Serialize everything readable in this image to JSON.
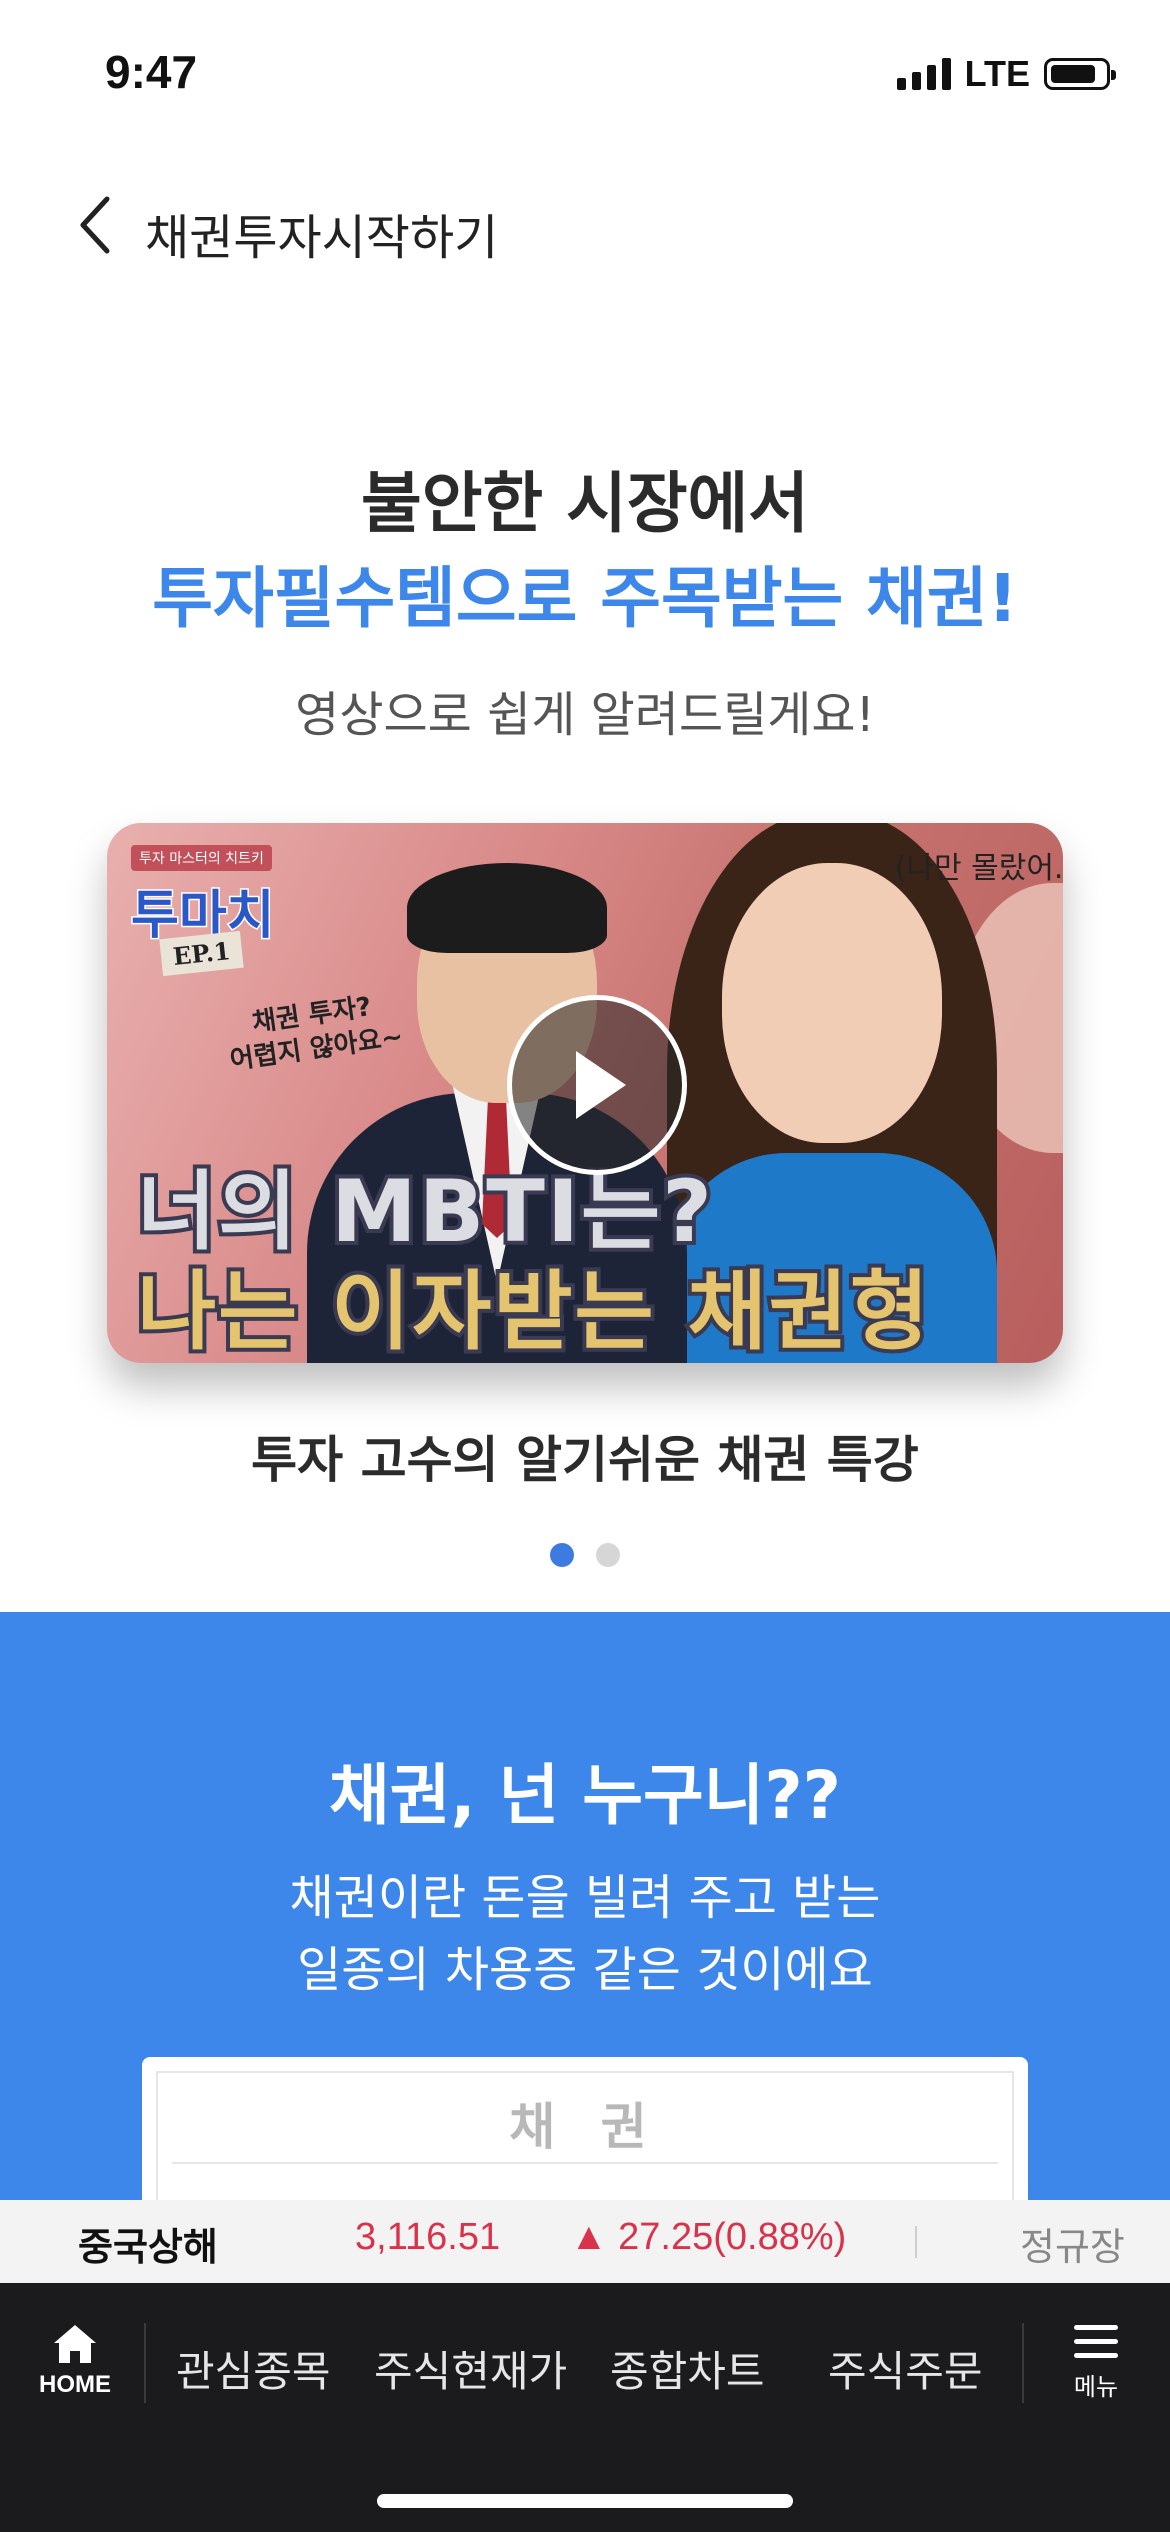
{
  "status_bar": {
    "time": "9:47",
    "network": "LTE"
  },
  "header": {
    "title": "채권투자시작하기"
  },
  "hero": {
    "line1": "불안한 시장에서",
    "line2": "투자필수템으로 주목받는 채권!",
    "subtitle": "영상으로 쉽게 알려드릴게요!"
  },
  "video": {
    "badge_small": "투자 마스터의 치트키",
    "badge_title": "투마치",
    "badge_ep": "EP.1",
    "bubble_text": "채권 투자?\n어렵지 않아요~",
    "corner_text": "(나만 몰랐어..",
    "thumb_title_line1": "너의 MBTI는?",
    "thumb_title_line2": "나는 이자받는 채권형",
    "caption": "투자 고수의 알기쉬운 채권 특강",
    "carousel": {
      "count": 2,
      "active_index": 0
    }
  },
  "intro": {
    "title": "채권, 넌 누구니??",
    "desc_line1": "채권이란 돈을 빌려 주고 받는",
    "desc_line2": "일종의 차용증 같은 것이에요",
    "card_label": "채 권"
  },
  "ticker": {
    "market": "중국상해",
    "price": "3,116.51",
    "change": "▲ 27.25(0.88%)",
    "session": "정규장",
    "up_color": "#d8334a"
  },
  "bottom_nav": {
    "home_label": "HOME",
    "items": [
      "관심종목",
      "주식현재가",
      "종합차트",
      "주식주문"
    ],
    "menu_label": "메뉴"
  },
  "colors": {
    "accent_blue": "#3d86ea",
    "nav_bg": "#1b1b1d"
  }
}
